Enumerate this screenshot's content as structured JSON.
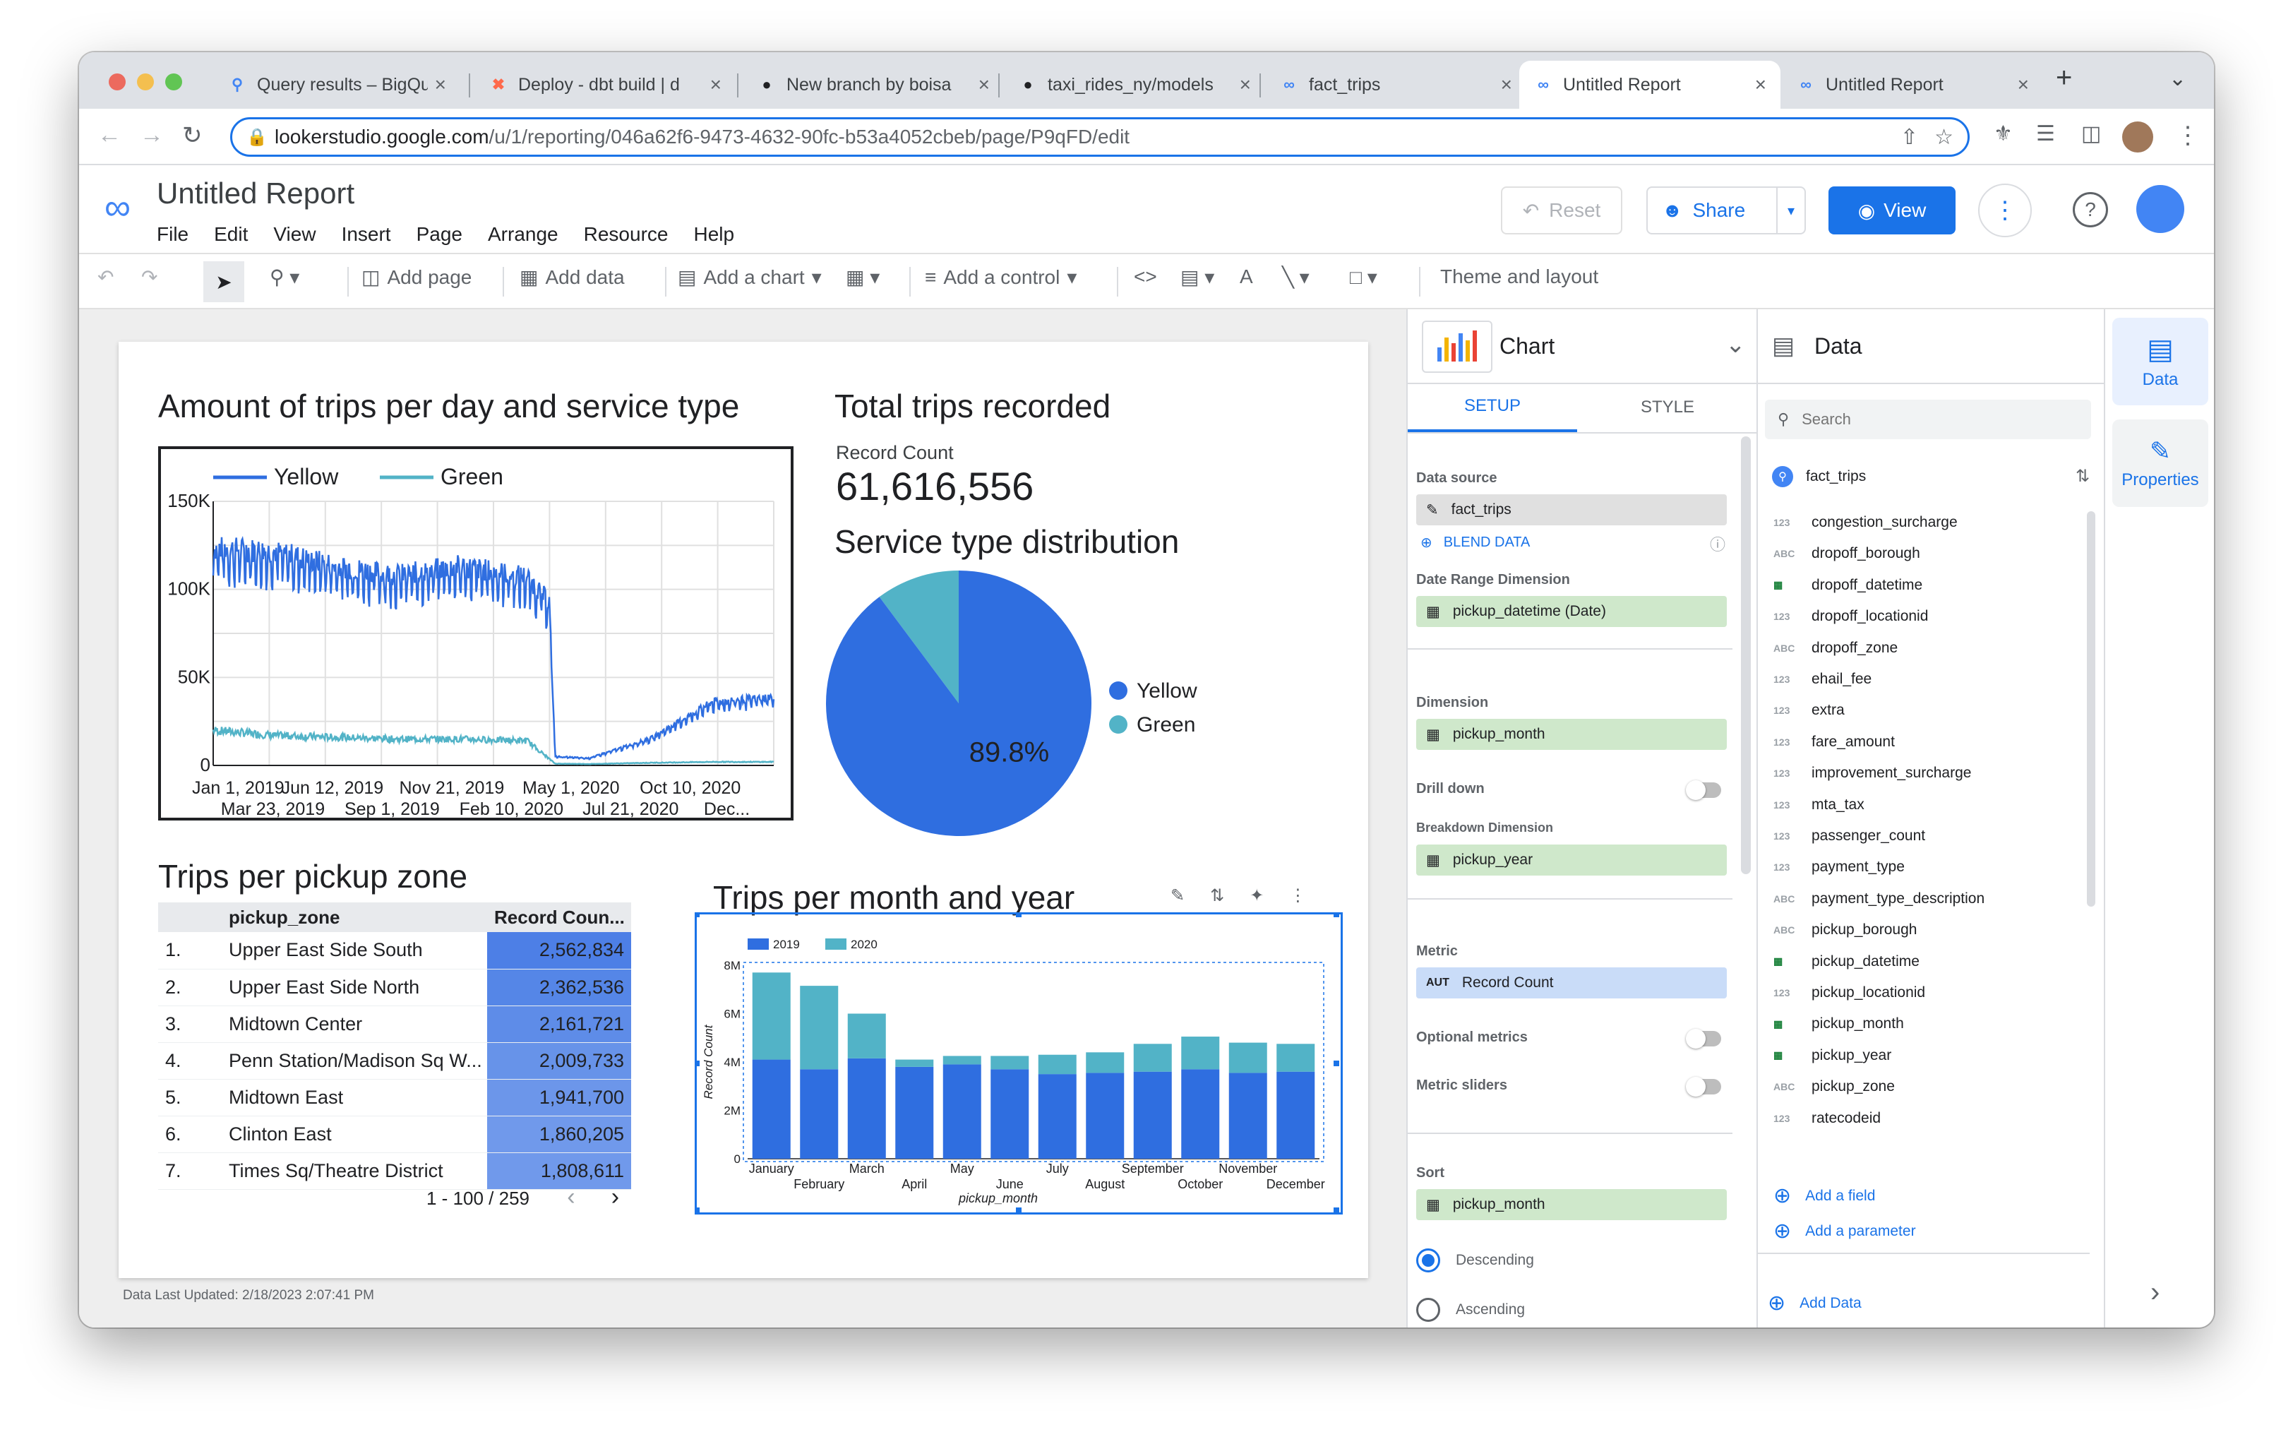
{
  "browser": {
    "tabs": [
      {
        "title": "Query results – BigQu",
        "favicon": "magnifier-icon"
      },
      {
        "title": "Deploy - dbt build | d",
        "favicon": "dbt-icon"
      },
      {
        "title": "New branch by boisa",
        "favicon": "github-icon"
      },
      {
        "title": "taxi_rides_ny/models",
        "favicon": "github-icon"
      },
      {
        "title": "fact_trips",
        "favicon": "looker-icon"
      },
      {
        "title": "Untitled Report",
        "favicon": "looker-icon",
        "active": true
      },
      {
        "title": "Untitled Report",
        "favicon": "looker-icon"
      }
    ],
    "url_host": "lookerstudio.google.com",
    "url_path": "/u/1/reporting/046a62f6-9473-4632-90fc-b53a4052cbeb/page/P9qFD/edit"
  },
  "app": {
    "title": "Untitled Report",
    "menu": [
      "File",
      "Edit",
      "View",
      "Insert",
      "Page",
      "Arrange",
      "Resource",
      "Help"
    ],
    "reset_label": "Reset",
    "share_label": "Share",
    "view_label": "View"
  },
  "toolbar": {
    "add_page": "Add page",
    "add_data": "Add data",
    "add_chart": "Add a chart",
    "add_control": "Add a control",
    "theme_layout": "Theme and layout"
  },
  "report": {
    "line_title": "Amount of trips per day and service type",
    "kpi_title": "Total trips recorded",
    "kpi_label": "Record Count",
    "kpi_value": "61,616,556",
    "pie_title": "Service type distribution",
    "table_title": "Trips per pickup zone",
    "bar_title": "Trips per month and year",
    "updated": "Data Last Updated: 2/18/2023 2:07:41 PM",
    "table": {
      "col_zone": "pickup_zone",
      "col_count": "Record Coun...",
      "rows": [
        {
          "n": "1.",
          "zone": "Upper East Side South",
          "count": "2,562,834",
          "value": 2562834
        },
        {
          "n": "2.",
          "zone": "Upper East Side North",
          "count": "2,362,536",
          "value": 2362536
        },
        {
          "n": "3.",
          "zone": "Midtown Center",
          "count": "2,161,721",
          "value": 2161721
        },
        {
          "n": "4.",
          "zone": "Penn Station/Madison Sq W...",
          "count": "2,009,733",
          "value": 2009733
        },
        {
          "n": "5.",
          "zone": "Midtown East",
          "count": "1,941,700",
          "value": 1941700
        },
        {
          "n": "6.",
          "zone": "Clinton East",
          "count": "1,860,205",
          "value": 1860205
        },
        {
          "n": "7.",
          "zone": "Times Sq/Theatre District",
          "count": "1,808,611",
          "value": 1808611
        }
      ],
      "pager": "1 - 100 / 259"
    }
  },
  "colors": {
    "yellow_series": "#2f6ee0",
    "green_series": "#52b3c7",
    "accent": "#1a73e8"
  },
  "chart_data": [
    {
      "type": "line",
      "title": "Amount of trips per day and service type",
      "series": [
        {
          "name": "Yellow",
          "points": [
            [
              "Jan 1, 2019",
              120000
            ],
            [
              "Mar 23, 2019",
              118000
            ],
            [
              "Jun 12, 2019",
              110000
            ],
            [
              "Sep 1, 2019",
              105000
            ],
            [
              "Nov 21, 2019",
              110000
            ],
            [
              "Feb 10, 2020",
              104000
            ],
            [
              "Mar 15, 2020",
              90000
            ],
            [
              "Mar 25, 2020",
              5000
            ],
            [
              "May 1, 2020",
              4000
            ],
            [
              "Jul 21, 2020",
              15000
            ],
            [
              "Oct 10, 2020",
              35000
            ],
            [
              "Dec 31, 2020",
              38000
            ]
          ]
        },
        {
          "name": "Green",
          "points": [
            [
              "Jan 1, 2019",
              20000
            ],
            [
              "Mar 23, 2019",
              17000
            ],
            [
              "Jun 12, 2019",
              16000
            ],
            [
              "Sep 1, 2019",
              15000
            ],
            [
              "Nov 21, 2019",
              15000
            ],
            [
              "Feb 10, 2020",
              14000
            ],
            [
              "Mar 25, 2020",
              1000
            ],
            [
              "May 1, 2020",
              800
            ],
            [
              "Jul 21, 2020",
              1500
            ],
            [
              "Oct 10, 2020",
              2000
            ],
            [
              "Dec 31, 2020",
              2000
            ]
          ]
        }
      ],
      "xticks_top": [
        "Jan 1, 2019",
        "Jun 12, 2019",
        "Nov 21, 2019",
        "May 1, 2020",
        "Oct 10, 2020"
      ],
      "xticks_bottom": [
        "Mar 23, 2019",
        "Sep 1, 2019",
        "Feb 10, 2020",
        "Jul 21, 2020",
        "Dec..."
      ],
      "yticks": [
        "150K",
        "100K",
        "50K",
        "0"
      ],
      "ylim": [
        0,
        150000
      ],
      "legend": "top"
    },
    {
      "type": "pie",
      "title": "Service type distribution",
      "slices": [
        {
          "name": "Yellow",
          "value": 89.8,
          "label": "89.8%"
        },
        {
          "name": "Green",
          "value": 10.2
        }
      ],
      "legend": "right"
    },
    {
      "type": "bar",
      "title": "Trips per month and year",
      "stacked": true,
      "xlabel": "pickup_month",
      "ylabel": "Record Count",
      "categories": [
        "January",
        "February",
        "March",
        "April",
        "May",
        "June",
        "July",
        "August",
        "September",
        "October",
        "November",
        "December"
      ],
      "series": [
        {
          "name": "2019",
          "values": [
            4100000,
            3700000,
            4150000,
            3800000,
            3900000,
            3700000,
            3500000,
            3550000,
            3600000,
            3700000,
            3550000,
            3600000
          ]
        },
        {
          "name": "2020",
          "values": [
            3600000,
            3450000,
            1850000,
            300000,
            350000,
            550000,
            800000,
            850000,
            1150000,
            1350000,
            1250000,
            1150000
          ]
        }
      ],
      "yticks": [
        "0",
        "2M",
        "4M",
        "6M",
        "8M"
      ],
      "ylim": [
        0,
        8000000
      ],
      "legend": "top-left"
    }
  ],
  "setup": {
    "chart_label": "Chart",
    "tab_setup": "SETUP",
    "tab_style": "STYLE",
    "data_source_label": "Data source",
    "data_source": "fact_trips",
    "blend": "BLEND DATA",
    "date_range_label": "Date Range Dimension",
    "date_range": "pickup_datetime (Date)",
    "dimension_label": "Dimension",
    "dimension": "pickup_month",
    "drill_down": "Drill down",
    "breakdown_label": "Breakdown Dimension",
    "breakdown": "pickup_year",
    "metric_label": "Metric",
    "metric_agg": "AUT",
    "metric": "Record Count",
    "optional_metrics": "Optional metrics",
    "metric_sliders": "Metric sliders",
    "sort_label": "Sort",
    "sort": "pickup_month",
    "descending": "Descending",
    "ascending": "Ascending"
  },
  "data_panel": {
    "title": "Data",
    "search_placeholder": "Search",
    "source": "fact_trips",
    "fields": [
      {
        "type": "123",
        "name": "congestion_surcharge"
      },
      {
        "type": "ABC",
        "name": "dropoff_borough"
      },
      {
        "type": "DATE",
        "name": "dropoff_datetime"
      },
      {
        "type": "123",
        "name": "dropoff_locationid"
      },
      {
        "type": "ABC",
        "name": "dropoff_zone"
      },
      {
        "type": "123",
        "name": "ehail_fee"
      },
      {
        "type": "123",
        "name": "extra"
      },
      {
        "type": "123",
        "name": "fare_amount"
      },
      {
        "type": "123",
        "name": "improvement_surcharge"
      },
      {
        "type": "123",
        "name": "mta_tax"
      },
      {
        "type": "123",
        "name": "passenger_count"
      },
      {
        "type": "123",
        "name": "payment_type"
      },
      {
        "type": "ABC",
        "name": "payment_type_description"
      },
      {
        "type": "ABC",
        "name": "pickup_borough"
      },
      {
        "type": "DATE",
        "name": "pickup_datetime"
      },
      {
        "type": "123",
        "name": "pickup_locationid"
      },
      {
        "type": "DATE",
        "name": "pickup_month"
      },
      {
        "type": "DATE",
        "name": "pickup_year"
      },
      {
        "type": "ABC",
        "name": "pickup_zone"
      },
      {
        "type": "123",
        "name": "ratecodeid"
      }
    ],
    "add_field": "Add a field",
    "add_parameter": "Add a parameter",
    "add_data": "Add Data"
  },
  "rail": {
    "data": "Data",
    "properties": "Properties"
  }
}
